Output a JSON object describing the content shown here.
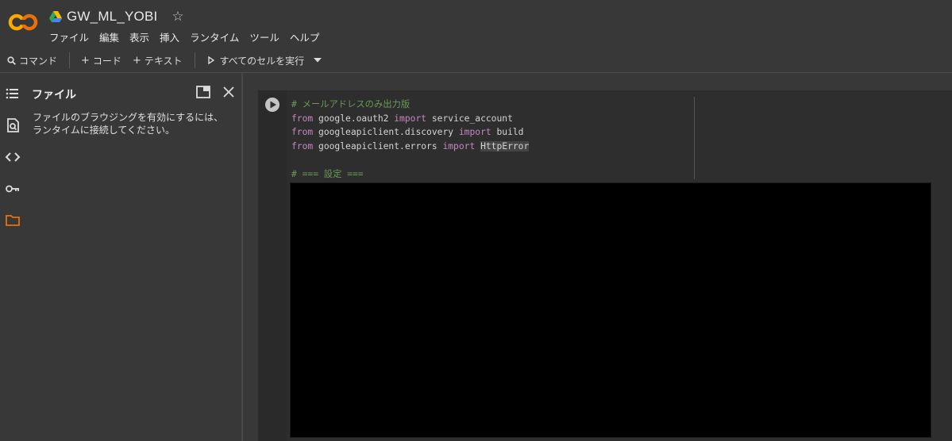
{
  "header": {
    "title": "GW_ML_YOBI",
    "star": "☆",
    "menu": [
      "ファイル",
      "編集",
      "表示",
      "挿入",
      "ランタイム",
      "ツール",
      "ヘルプ"
    ]
  },
  "toolbar": {
    "command": "コマンド",
    "code": "コード",
    "text": "テキスト",
    "run_all": "すべてのセルを実行"
  },
  "panel": {
    "title": "ファイル",
    "message": "ファイルのブラウジングを有効にするには、ランタイムに接続してください。"
  },
  "cell": {
    "comment": "# メールアドレスのみ出力版",
    "line2": {
      "from": "from",
      "module": " google.oauth2 ",
      "import": "import",
      "name": " service_account"
    },
    "line3": {
      "from": "from",
      "module": " googleapiclient.discovery ",
      "import": "import",
      "name": " build"
    },
    "line4": {
      "from": "from",
      "module": " googleapiclient.errors ",
      "import": "import",
      "name": "HttpError"
    },
    "section": "# === 設定 ==="
  },
  "colors": {
    "accent_orange": "#f9ab00",
    "comment_green": "#6a9955",
    "keyword_purple": "#c586c0"
  }
}
